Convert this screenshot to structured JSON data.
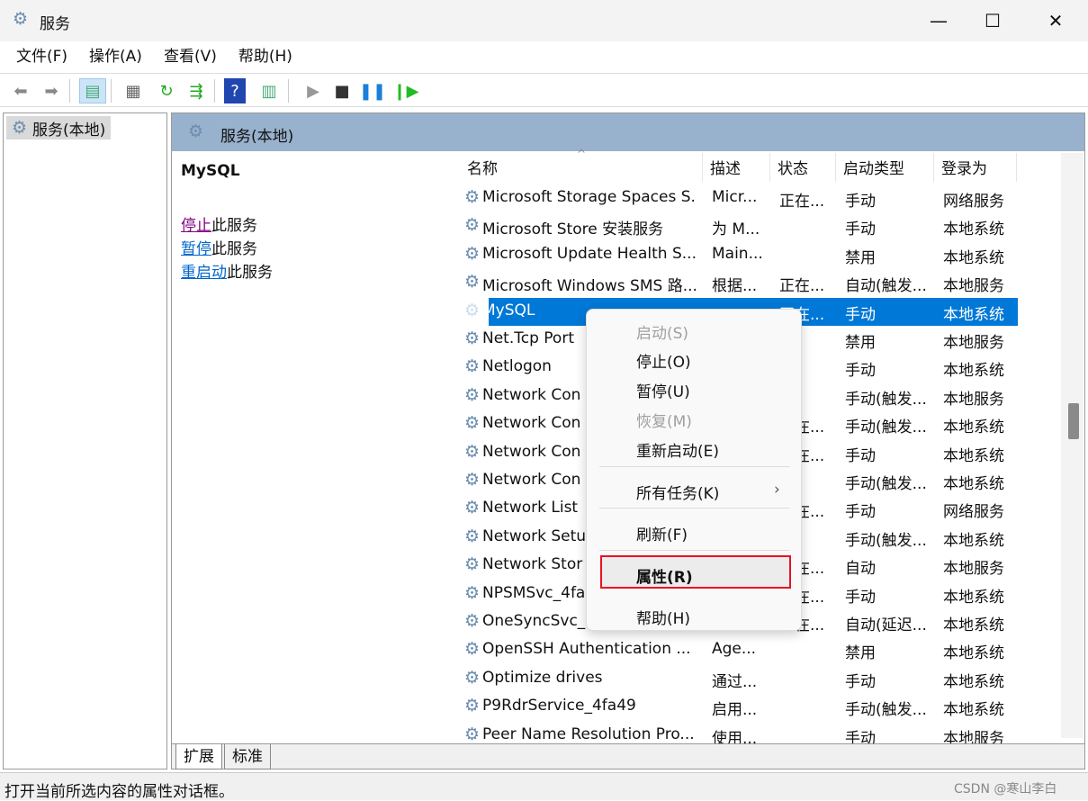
{
  "window": {
    "title": "服务",
    "min": "—",
    "max": "☐",
    "close": "✕"
  },
  "menubar": [
    "文件(F)",
    "操作(A)",
    "查看(V)",
    "帮助(H)"
  ],
  "tree": {
    "root": "服务(本地)"
  },
  "panel": {
    "header": "服务(本地)",
    "service_name": "MySQL",
    "stop_link": "停止",
    "stop_rest": "此服务",
    "pause_link": "暂停",
    "pause_rest": "此服务",
    "restart_link": "重启动",
    "restart_rest": "此服务"
  },
  "columns": [
    "名称",
    "描述",
    "状态",
    "启动类型",
    "登录为"
  ],
  "rows": [
    [
      "Microsoft Storage Spaces S...",
      "Micr...",
      "正在...",
      "手动",
      "网络服务"
    ],
    [
      "Microsoft Store 安装服务",
      "为 M...",
      "",
      "手动",
      "本地系统"
    ],
    [
      "Microsoft Update Health S...",
      "Main...",
      "",
      "禁用",
      "本地系统"
    ],
    [
      "Microsoft Windows SMS 路...",
      "根据...",
      "正在...",
      "自动(触发...",
      "本地服务"
    ],
    [
      "MySQL",
      "",
      "正在...",
      "手动",
      "本地系统"
    ],
    [
      "Net.Tcp Port",
      "",
      "",
      "禁用",
      "本地服务"
    ],
    [
      "Netlogon",
      "",
      "",
      "手动",
      "本地系统"
    ],
    [
      "Network Con",
      "",
      "",
      "手动(触发...",
      "本地服务"
    ],
    [
      "Network Con",
      "",
      "正在...",
      "手动(触发...",
      "本地系统"
    ],
    [
      "Network Con",
      "",
      "正在...",
      "手动",
      "本地系统"
    ],
    [
      "Network Con",
      "",
      "",
      "手动(触发...",
      "本地系统"
    ],
    [
      "Network List",
      "",
      "正在...",
      "手动",
      "网络服务"
    ],
    [
      "Network Setu",
      "",
      "",
      "手动(触发...",
      "本地系统"
    ],
    [
      "Network Stor",
      "",
      "正在...",
      "自动",
      "本地服务"
    ],
    [
      "NPSMSvc_4fa",
      "",
      "正在...",
      "手动",
      "本地系统"
    ],
    [
      "OneSyncSvc_",
      "",
      "正在...",
      "自动(延迟...",
      "本地系统"
    ],
    [
      "OpenSSH Authentication ...",
      "Age...",
      "",
      "禁用",
      "本地系统"
    ],
    [
      "Optimize drives",
      "通过...",
      "",
      "手动",
      "本地系统"
    ],
    [
      "P9RdrService_4fa49",
      "启用...",
      "",
      "手动(触发...",
      "本地系统"
    ],
    [
      "Peer Name Resolution Pro...",
      "使用...",
      "",
      "手动",
      "本地服务"
    ]
  ],
  "selected_row": 4,
  "context_menu": [
    {
      "label": "启动(S)",
      "disabled": true
    },
    {
      "label": "停止(O)"
    },
    {
      "label": "暂停(U)"
    },
    {
      "label": "恢复(M)",
      "disabled": true
    },
    {
      "label": "重新启动(E)"
    },
    {
      "label": "所有任务(K)",
      "submenu": true
    },
    {
      "label": "刷新(F)"
    },
    {
      "label": "属性(R)",
      "highlighted": true
    },
    {
      "label": "帮助(H)"
    }
  ],
  "tabs": [
    "扩展",
    "标准"
  ],
  "statusbar": "打开当前所选内容的属性对话框。",
  "watermark": "CSDN @寒山李白",
  "colors": {
    "selection": "#0078d7",
    "highlight_box": "#e81123",
    "header": "#98b1cc"
  }
}
